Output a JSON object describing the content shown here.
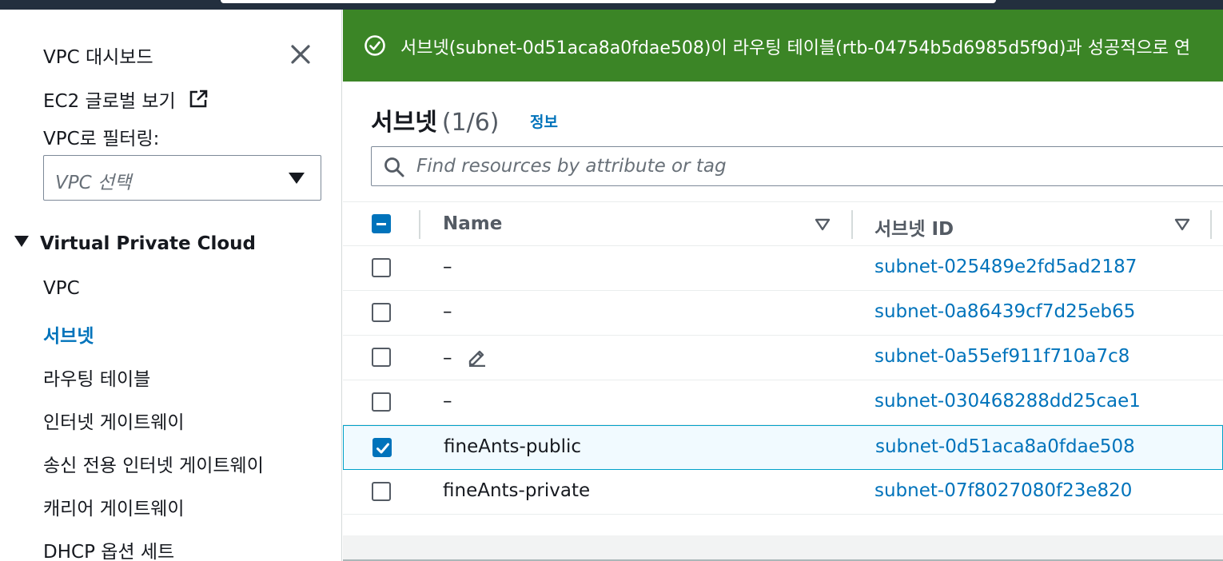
{
  "sidebar": {
    "dashboard": "VPC 대시보드",
    "ec2_global": "EC2 글로벌 보기",
    "filter_label": "VPC로 필터링:",
    "filter_placeholder": "VPC 선택",
    "section_title": "Virtual Private Cloud",
    "items": [
      {
        "label": "VPC",
        "active": false
      },
      {
        "label": "서브넷",
        "active": true
      },
      {
        "label": "라우팅 테이블",
        "active": false
      },
      {
        "label": "인터넷 게이트웨이",
        "active": false
      },
      {
        "label": "송신 전용 인터넷 게이트웨이",
        "active": false
      },
      {
        "label": "캐리어 게이트웨이",
        "active": false
      },
      {
        "label": "DHCP 옵션 세트",
        "active": false
      }
    ]
  },
  "flash": {
    "message": "서브넷(subnet-0d51aca8a0fdae508)이 라우팅 테이블(rtb-04754b5d6985d5f9d)과 성공적으로 연",
    "color": "#3b8526"
  },
  "main": {
    "title": "서브넷",
    "count": "(1/6)",
    "info_link": "정보",
    "search_placeholder": "Find resources by attribute or tag"
  },
  "table": {
    "columns": [
      "Name",
      "서브넷 ID"
    ],
    "rows": [
      {
        "name": "–",
        "subnet_id": "subnet-025489e2fd5ad2187",
        "selected": false,
        "edit_icon": false
      },
      {
        "name": "–",
        "subnet_id": "subnet-0a86439cf7d25eb65",
        "selected": false,
        "edit_icon": false
      },
      {
        "name": "–",
        "subnet_id": "subnet-0a55ef911f710a7c8",
        "selected": false,
        "edit_icon": true
      },
      {
        "name": "–",
        "subnet_id": "subnet-030468288dd25cae1",
        "selected": false,
        "edit_icon": false
      },
      {
        "name": "fineAnts-public",
        "subnet_id": "subnet-0d51aca8a0fdae508",
        "selected": true,
        "edit_icon": false
      },
      {
        "name": "fineAnts-private",
        "subnet_id": "subnet-07f8027080f23e820",
        "selected": false,
        "edit_icon": false
      }
    ]
  },
  "colors": {
    "link": "#0073bb",
    "success": "#3b8526",
    "nav_bar": "#232f3e"
  }
}
